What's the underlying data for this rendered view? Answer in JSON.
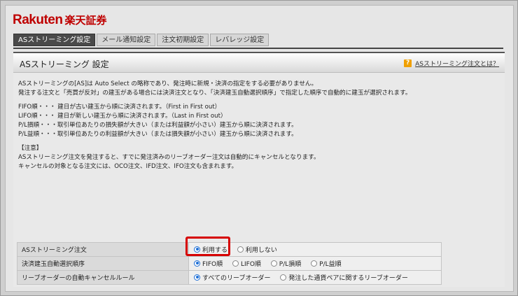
{
  "brand": {
    "rakuten": "Rakuten",
    "shoken": "楽天証券"
  },
  "tabs": [
    {
      "label": "ASストリーミング設定",
      "active": true
    },
    {
      "label": "メール通知設定",
      "active": false
    },
    {
      "label": "注文初期設定",
      "active": false
    },
    {
      "label": "レバレッジ設定",
      "active": false
    }
  ],
  "header": {
    "title": "ASストリーミング 設定",
    "help_icon": "?",
    "help_link": "ASストリーミング注文とは？"
  },
  "description": {
    "intro": [
      "ASストリーミングの[AS]は Auto Select の略称であり、発注時に新規・決済の指定をする必要がありません。",
      "発注する注文と「売買が反対」の建玉がある場合には決済注文となり、「決済建玉自動選択順序」で指定した順序で自動的に建玉が選択されます。"
    ],
    "rules": [
      "FIFO順・・・ 建日が古い建玉から順に決済されます。（First in First out）",
      "LIFO順・・・ 建日が新しい建玉から順に決済されます。（Last in First out）",
      "P/L損順・・・取引単位あたりの損失額が大きい（または利益額が小さい）建玉から順に決済されます。",
      "P/L益順・・・取引単位あたりの利益額が大きい（または損失額が小さい）建玉から順に決済されます。"
    ],
    "notes": [
      "【注意】",
      "ASストリーミング注文を発注すると、すでに発注済みのリーブオーダー注文は自動的にキャンセルとなります。",
      "キャンセルの対象となる注文には、OCO注文、IFD注文、IFO注文も含まれます。"
    ]
  },
  "settings": {
    "as_streaming": {
      "label": "ASストリーミング注文",
      "options": [
        "利用する",
        "利用しない"
      ],
      "selected": "利用する"
    },
    "auto_select_order": {
      "label": "決済建玉自動選択順序",
      "options": [
        "FIFO順",
        "LIFO順",
        "P/L損順",
        "P/L益順"
      ],
      "selected": "FIFO順"
    },
    "leave_order_cancel": {
      "label": "リーブオーダーの自動キャンセルルール",
      "options": [
        "すべてのリーブオーダー",
        "発注した通貨ペアに関するリーブオーダー"
      ],
      "selected": "すべてのリーブオーダー"
    }
  },
  "colors": {
    "brand_red": "#bf0000",
    "radio_selected": "#1f6fd6",
    "highlight": "#d60000",
    "help_icon": "#f0a000"
  }
}
